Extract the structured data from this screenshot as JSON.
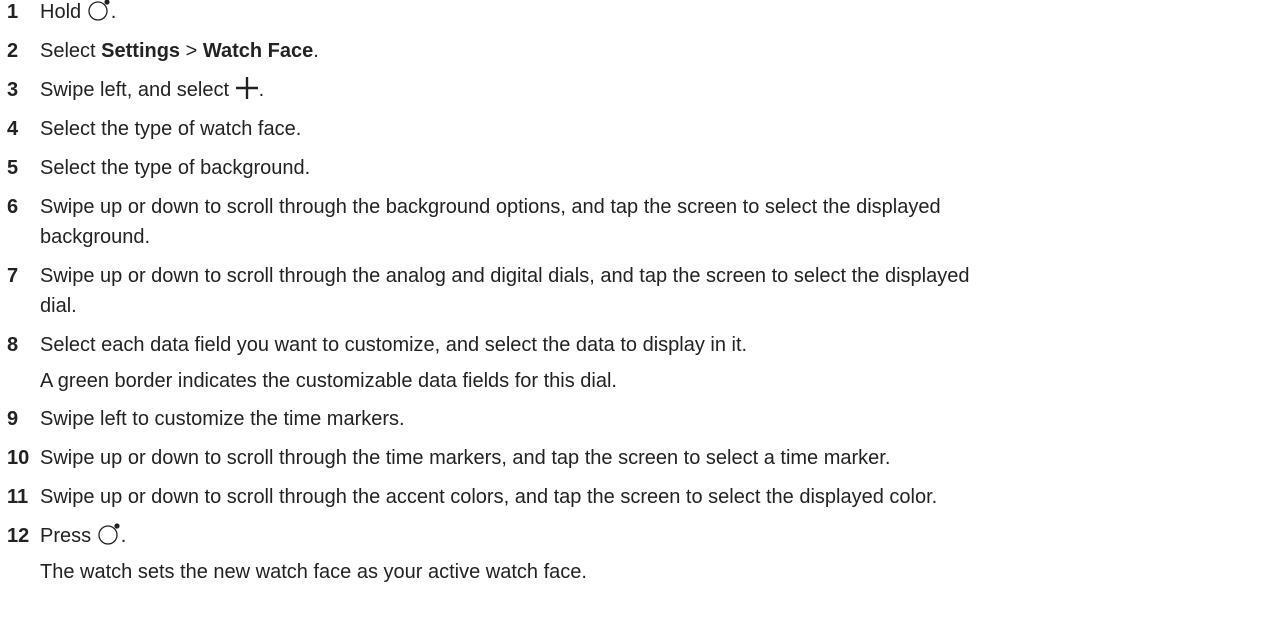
{
  "steps": [
    {
      "num": "1",
      "pre": "Hold ",
      "icon": "watch-button-icon",
      "post": "."
    },
    {
      "num": "2",
      "pre": "Select ",
      "b1": "Settings",
      "mid": " > ",
      "b2": "Watch Face",
      "post": "."
    },
    {
      "num": "3",
      "pre": "Swipe left, and select ",
      "icon": "plus-icon",
      "post": "."
    },
    {
      "num": "4",
      "text": "Select the type of watch face."
    },
    {
      "num": "5",
      "text": "Select the type of background."
    },
    {
      "num": "6",
      "line1": "Swipe up or down to scroll through the background options, and tap the screen to select the displayed",
      "line2": "background."
    },
    {
      "num": "7",
      "line1": "Swipe up or down to scroll through the analog and digital dials, and tap the screen to select the displayed",
      "line2": "dial."
    },
    {
      "num": "8",
      "text": "Select each data field you want to customize, and select the data to display in it.",
      "note": "A green border indicates the customizable data fields for this dial."
    },
    {
      "num": "9",
      "text": "Swipe left to customize the time markers."
    },
    {
      "num": "10",
      "text": "Swipe up or down to scroll through the time markers, and tap the screen to select a time marker."
    },
    {
      "num": "11",
      "text": "Swipe up or down to scroll through the accent colors, and tap the screen to select the displayed color."
    },
    {
      "num": "12",
      "pre": "Press ",
      "icon": "watch-button-icon",
      "post": ".",
      "note": "The watch sets the new watch face as your active watch face."
    }
  ]
}
